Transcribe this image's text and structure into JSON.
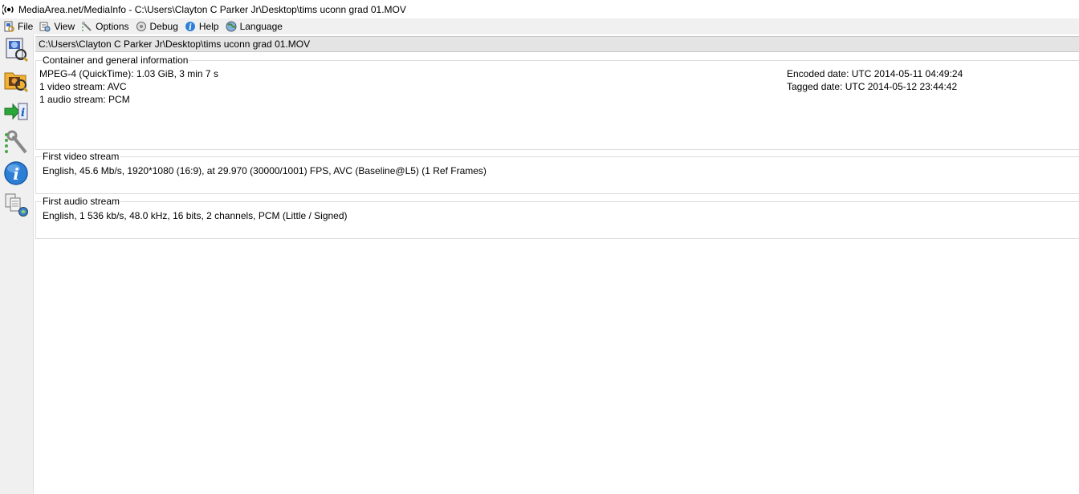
{
  "window": {
    "title": "MediaArea.net/MediaInfo - C:\\Users\\Clayton C Parker Jr\\Desktop\\tims uconn grad 01.MOV"
  },
  "menu": {
    "items": [
      {
        "label": "File",
        "icon": "file-icon"
      },
      {
        "label": "View",
        "icon": "view-icon"
      },
      {
        "label": "Options",
        "icon": "options-icon"
      },
      {
        "label": "Debug",
        "icon": "debug-icon"
      },
      {
        "label": "Help",
        "icon": "help-icon"
      },
      {
        "label": "Language",
        "icon": "language-icon"
      }
    ]
  },
  "toolbar": {
    "icons": [
      "open-file-icon",
      "open-folder-icon",
      "export-icon",
      "preferences-icon",
      "about-icon",
      "knowledge-icon"
    ]
  },
  "file_path": "C:\\Users\\Clayton C Parker Jr\\Desktop\\tims uconn grad 01.MOV",
  "general": {
    "heading": "Container and general information",
    "format": "MPEG-4 (QuickTime): 1.03 GiB, 3 min 7 s",
    "video_streams": "1 video stream: AVC",
    "audio_streams": "1 audio stream: PCM",
    "encoded_date": "Encoded date: UTC 2014-05-11 04:49:24",
    "tagged_date": "Tagged date: UTC 2014-05-12 23:44:42"
  },
  "video": {
    "heading": "First video stream",
    "details": "English, 45.6 Mb/s, 1920*1080 (16:9), at 29.970 (30000/1001) FPS, AVC (Baseline@L5) (1 Ref Frames)"
  },
  "audio": {
    "heading": "First audio stream",
    "details": "English, 1 536 kb/s, 48.0 kHz, 16 bits, 2 channels, PCM (Little / Signed)"
  }
}
